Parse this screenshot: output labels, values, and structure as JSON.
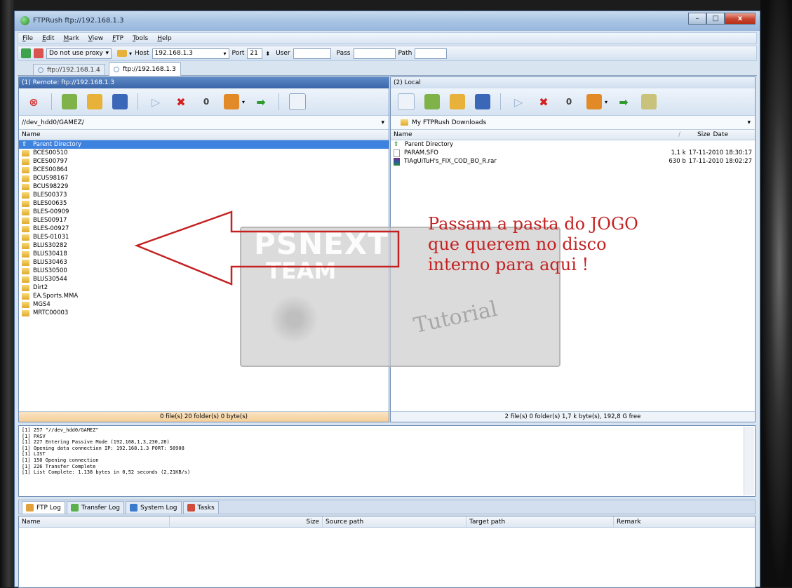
{
  "window": {
    "title": "FTPRush  ftp://192.168.1.3",
    "min": "–",
    "max": "□",
    "close": "x"
  },
  "menu": [
    "File",
    "Edit",
    "Mark",
    "View",
    "FTP",
    "Tools",
    "Help"
  ],
  "address": {
    "proxy": "Do not use proxy",
    "host_label": "Host",
    "host": "192.168.1.3",
    "port_label": "Port",
    "port": "21",
    "user_label": "User",
    "user": "",
    "pass_label": "Pass",
    "path_label": "Path"
  },
  "tabs": [
    "ftp://192.168.1.4",
    "ftp://192.168.1.3"
  ],
  "remote": {
    "title": "(1) Remote:  ftp://192.168.1.3",
    "path": "//dev_hdd0/GAMEZ/",
    "col_name": "Name",
    "parent": "Parent Directory",
    "folders": [
      "BCES00510",
      "BCES00797",
      "BCES00864",
      "BCUS98167",
      "BCUS98229",
      "BLES00373",
      "BLES00635",
      "BLES-00909",
      "BLES00917",
      "BLES-00927",
      "BLES-01031",
      "BLUS30282",
      "BLUS30418",
      "BLUS30463",
      "BLUS30500",
      "BLUS30544",
      "Dirt2",
      "EA.Sports.MMA",
      "MGS4",
      "MRTC00003"
    ],
    "status": "0 file(s) 20 folder(s) 0 byte(s)"
  },
  "local": {
    "title": "(2) Local",
    "path": "My FTPRush Downloads",
    "col_name": "Name",
    "col_sort": "/",
    "col_size": "Size",
    "col_date": "Date",
    "parent": "Parent Directory",
    "files": [
      {
        "name": "PARAM.SFO",
        "size": "1,1 k",
        "date": "17-11-2010 18:30:17"
      },
      {
        "name": "TiAgUiTuH's_FIX_COD_BO_R.rar",
        "size": "630 b",
        "date": "17-11-2010 18:02:27"
      }
    ],
    "status": "2 file(s) 0 folder(s) 1,7 k byte(s), 192,8 G free"
  },
  "log": [
    "[1] 257 \"//dev_hdd0/GAMEZ\"",
    "[1] PASV",
    "[1] 227 Entering Passive Mode (192,168,1,3,230,28)",
    "[1] Opening data connection IP: 192.168.1.3 PORT: 58908",
    "[1] LIST",
    "[1] 150 Opening connection",
    "[1] 226 Transfer Complete",
    "[1] List Complete: 1.138 bytes in 0,52 seconds (2,21KB/s)"
  ],
  "log_tabs": [
    "FTP Log",
    "Transfer Log",
    "System Log",
    "Tasks"
  ],
  "transfer_cols": {
    "name": "Name",
    "size": "Size",
    "source": "Source path",
    "target": "Target path",
    "remark": "Remark"
  },
  "watermark": {
    "line1": "PSNEXT",
    "line2": "TEAM",
    "tutorial": "Tutorial"
  },
  "annotation": "Passam a pasta do JOGO\nque querem no disco\ninterno para aqui !",
  "colors": {
    "accent": "#3e82e0",
    "annotation": "#c42222",
    "arrow": "#c42222"
  }
}
